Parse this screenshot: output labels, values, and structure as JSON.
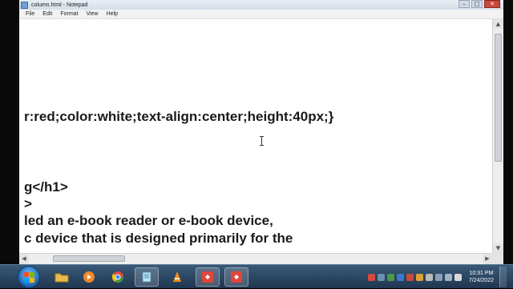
{
  "window": {
    "title": "column.html - Notepad",
    "controls": [
      "–",
      "□",
      "✕"
    ]
  },
  "menu": {
    "items": [
      "File",
      "Edit",
      "Format",
      "View",
      "Help"
    ]
  },
  "editor": {
    "lines": [
      "r:red;color:white;text-align:center;height:40px;}",
      "g</h1>",
      ">",
      "led an e-book reader or e-book device,",
      "c device that is designed primarily for the"
    ]
  },
  "taskbar": {
    "apps": [
      {
        "icon": "explorer-folder-icon",
        "color": "#e9b94a"
      },
      {
        "icon": "media-player-icon",
        "color": "#f08a2a"
      },
      {
        "icon": "chrome-icon",
        "color": "#3c9a45"
      },
      {
        "icon": "notepad-icon",
        "color": "#8fd0ea"
      },
      {
        "icon": "vlc-icon",
        "color": "#f28c1c"
      },
      {
        "icon": "anydesk-icon",
        "color": "#e0453a"
      },
      {
        "icon": "anydesk-icon",
        "color": "#e0453a"
      }
    ],
    "clock": {
      "time": "10:31 PM",
      "date": "7/24/2022"
    }
  },
  "colors": {
    "text": "#1a1a1a",
    "taskbar": "#1f3650",
    "editor_bg": "#ffffff"
  }
}
